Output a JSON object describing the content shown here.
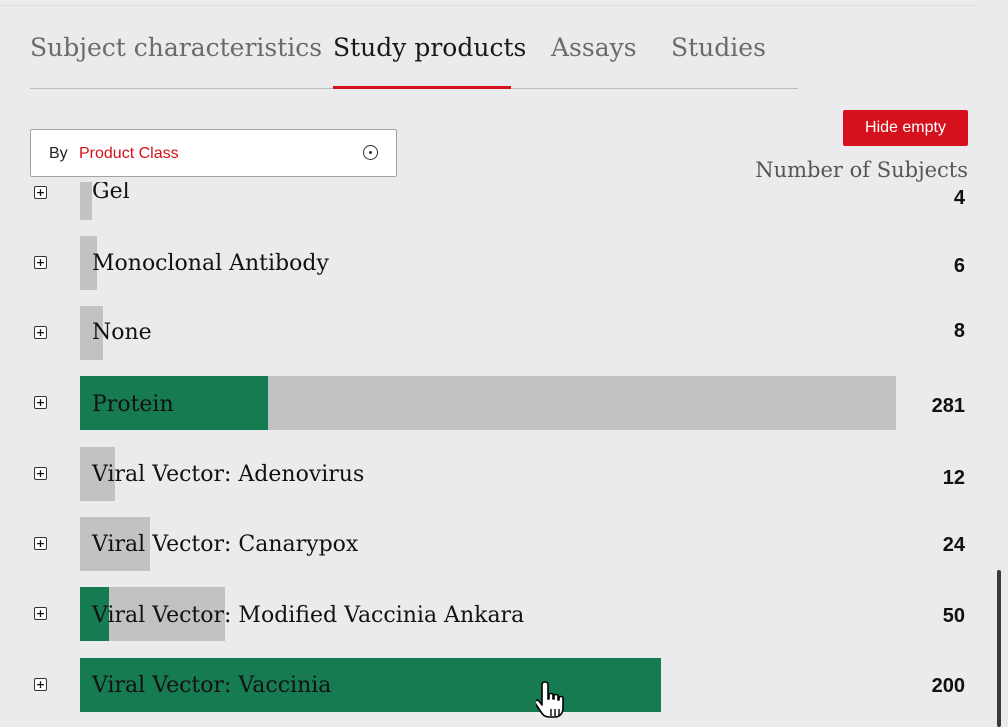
{
  "tabs": [
    {
      "label": "Subject characteristics"
    },
    {
      "label": "Study products"
    },
    {
      "label": "Assays"
    },
    {
      "label": "Studies"
    }
  ],
  "filter": {
    "prefix": "By",
    "value": "Product Class"
  },
  "hide_empty_label": "Hide empty",
  "column_header": "Number of Subjects",
  "colors": {
    "accent": "#d4111c",
    "bar_fill": "#177b51",
    "bar_total": "#c2c2c4"
  },
  "rows": [
    {
      "label": "Gel",
      "count": "4",
      "fill_fraction": 0.0
    },
    {
      "label": "Monoclonal Antibody",
      "count": "6",
      "fill_fraction": 0.0
    },
    {
      "label": "None",
      "count": "8",
      "fill_fraction": 0.0
    },
    {
      "label": "Protein",
      "count": "281",
      "fill_fraction": 0.23
    },
    {
      "label": "Viral Vector: Adenovirus",
      "count": "12",
      "fill_fraction": 0.0
    },
    {
      "label": "Viral Vector: Canarypox",
      "count": "24",
      "fill_fraction": 0.0
    },
    {
      "label": "Viral Vector: Modified Vaccinia Ankara",
      "count": "50",
      "fill_fraction": 0.2
    },
    {
      "label": "Viral Vector: Vaccinia",
      "count": "200",
      "fill_fraction": 1.0
    }
  ]
}
